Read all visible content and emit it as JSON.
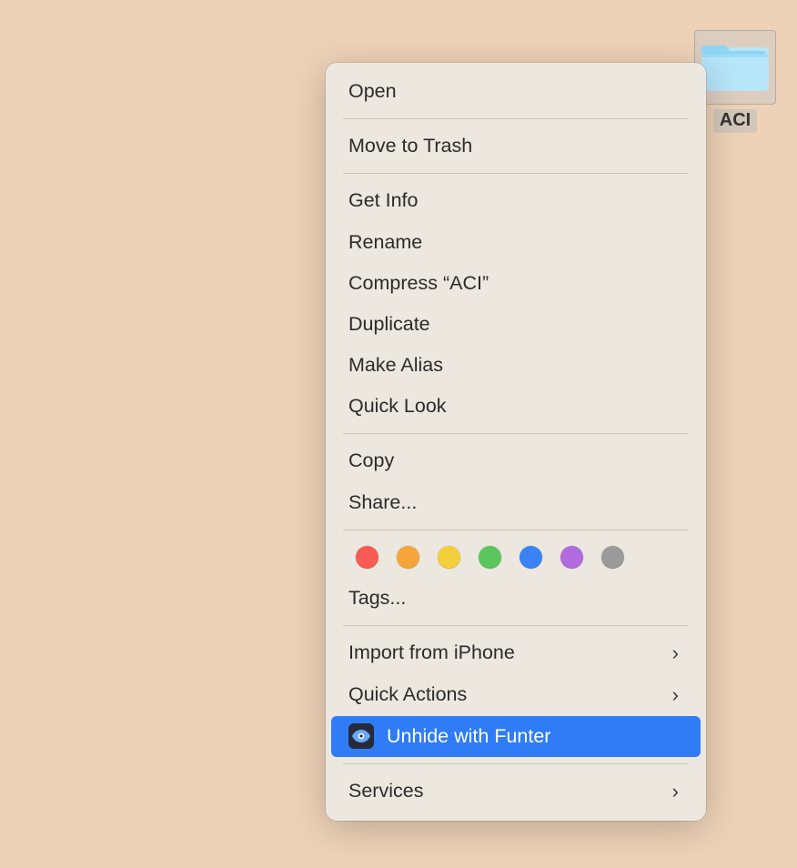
{
  "folder": {
    "name": "ACI"
  },
  "menu": {
    "open": "Open",
    "trash": "Move to Trash",
    "info": "Get Info",
    "rename": "Rename",
    "compress": "Compress “ACI”",
    "duplicate": "Duplicate",
    "alias": "Make Alias",
    "quicklook": "Quick Look",
    "copy": "Copy",
    "share": "Share...",
    "tags": "Tags...",
    "import": "Import from iPhone",
    "quick_actions": "Quick Actions",
    "unhide": "Unhide with Funter",
    "services": "Services"
  },
  "tag_colors": [
    "#f75b53",
    "#f5a53a",
    "#f5cf3b",
    "#5bc65b",
    "#3b82f6",
    "#b06bdc",
    "#9a9a9a"
  ]
}
